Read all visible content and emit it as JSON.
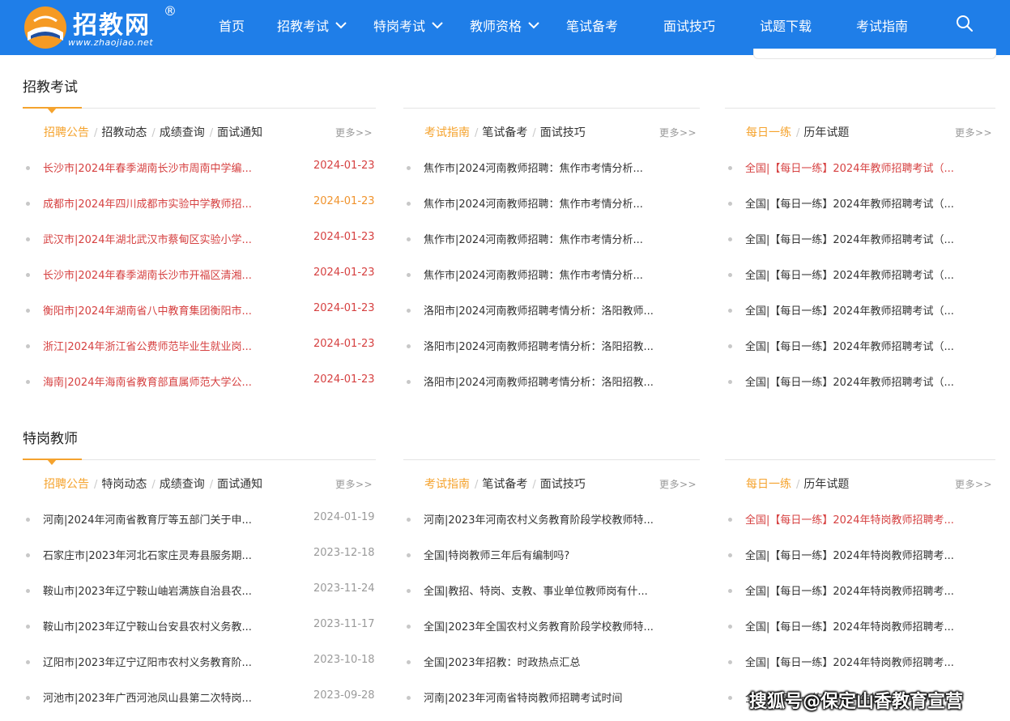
{
  "header": {
    "logo_name": "招教网",
    "logo_reg": "®",
    "logo_url": "www.zhaojiao.net",
    "nav": [
      {
        "label": "首页",
        "has_dropdown": false
      },
      {
        "label": "招教考试",
        "has_dropdown": true
      },
      {
        "label": "特岗考试",
        "has_dropdown": true
      },
      {
        "label": "教师资格",
        "has_dropdown": true
      },
      {
        "label": "笔试备考",
        "has_dropdown": false
      },
      {
        "label": "面试技巧",
        "has_dropdown": false
      },
      {
        "label": "试题下载",
        "has_dropdown": false
      },
      {
        "label": "考试指南",
        "has_dropdown": false
      }
    ],
    "search_icon": "search-icon"
  },
  "colors": {
    "header_bg": "#1f7ee8",
    "accent": "#f5a32e",
    "link_red": "#d64141",
    "date_orange": "#f0932d"
  },
  "sections": [
    {
      "title": "招教考试",
      "columns": [
        {
          "tabs": [
            "招聘公告",
            "招教动态",
            "成绩查询",
            "面试通知"
          ],
          "active_tab": 0,
          "more": "更多>>",
          "items": [
            {
              "text": "长沙市|2024年春季湖南长沙市周南中学编...",
              "date": "2024-01-23",
              "style": "red",
              "date_style": "red"
            },
            {
              "text": "成都市|2024年四川成都市实验中学教师招...",
              "date": "2024-01-23",
              "style": "red",
              "date_style": "orange"
            },
            {
              "text": "武汉市|2024年湖北武汉市蔡甸区实验小学...",
              "date": "2024-01-23",
              "style": "red",
              "date_style": "red"
            },
            {
              "text": "长沙市|2024年春季湖南长沙市开福区清湘...",
              "date": "2024-01-23",
              "style": "red",
              "date_style": "red"
            },
            {
              "text": "衡阳市|2024年湖南省八中教育集团衡阳市...",
              "date": "2024-01-23",
              "style": "red",
              "date_style": "red"
            },
            {
              "text": "浙江|2024年浙江省公费师范毕业生就业岗...",
              "date": "2024-01-23",
              "style": "red",
              "date_style": "red"
            },
            {
              "text": "海南|2024年海南省教育部直属师范大学公...",
              "date": "2024-01-23",
              "style": "red",
              "date_style": "red"
            }
          ]
        },
        {
          "tabs": [
            "考试指南",
            "笔试备考",
            "面试技巧"
          ],
          "active_tab": 0,
          "more": "更多>>",
          "items": [
            {
              "text": "焦作市|2024河南教师招聘：焦作市考情分析...",
              "style": "dark"
            },
            {
              "text": "焦作市|2024河南教师招聘：焦作市考情分析...",
              "style": "dark"
            },
            {
              "text": "焦作市|2024河南教师招聘：焦作市考情分析...",
              "style": "dark"
            },
            {
              "text": "焦作市|2024河南教师招聘：焦作市考情分析...",
              "style": "dark"
            },
            {
              "text": "洛阳市|2024河南教师招聘考情分析：洛阳教师...",
              "style": "dark"
            },
            {
              "text": "洛阳市|2024河南教师招聘考情分析：洛阳招教...",
              "style": "dark"
            },
            {
              "text": "洛阳市|2024河南教师招聘考情分析：洛阳招教...",
              "style": "dark"
            }
          ]
        },
        {
          "tabs": [
            "每日一练",
            "历年试题"
          ],
          "active_tab": 0,
          "more": "更多>>",
          "items": [
            {
              "text": "全国|【每日一练】2024年教师招聘考试（...",
              "style": "red"
            },
            {
              "text": "全国|【每日一练】2024年教师招聘考试（...",
              "style": "dark"
            },
            {
              "text": "全国|【每日一练】2024年教师招聘考试（...",
              "style": "dark"
            },
            {
              "text": "全国|【每日一练】2024年教师招聘考试（...",
              "style": "dark"
            },
            {
              "text": "全国|【每日一练】2024年教师招聘考试（...",
              "style": "dark"
            },
            {
              "text": "全国|【每日一练】2024年教师招聘考试（...",
              "style": "dark"
            },
            {
              "text": "全国|【每日一练】2024年教师招聘考试（...",
              "style": "dark"
            }
          ]
        }
      ]
    },
    {
      "title": "特岗教师",
      "columns": [
        {
          "tabs": [
            "招聘公告",
            "特岗动态",
            "成绩查询",
            "面试通知"
          ],
          "active_tab": 0,
          "more": "更多>>",
          "items": [
            {
              "text": "河南|2024年河南省教育厅等五部门关于申...",
              "date": "2024-01-19",
              "style": "dark",
              "date_style": "gray"
            },
            {
              "text": "石家庄市|2023年河北石家庄灵寿县服务期...",
              "date": "2023-12-18",
              "style": "dark",
              "date_style": "gray"
            },
            {
              "text": "鞍山市|2023年辽宁鞍山岫岩满族自治县农...",
              "date": "2023-11-24",
              "style": "dark",
              "date_style": "gray"
            },
            {
              "text": "鞍山市|2023年辽宁鞍山台安县农村义务教...",
              "date": "2023-11-17",
              "style": "dark",
              "date_style": "gray"
            },
            {
              "text": "辽阳市|2023年辽宁辽阳市农村义务教育阶...",
              "date": "2023-10-18",
              "style": "dark",
              "date_style": "gray"
            },
            {
              "text": "河池市|2023年广西河池凤山县第二次特岗...",
              "date": "2023-09-28",
              "style": "dark",
              "date_style": "gray"
            }
          ]
        },
        {
          "tabs": [
            "考试指南",
            "笔试备考",
            "面试技巧"
          ],
          "active_tab": 0,
          "more": "更多>>",
          "items": [
            {
              "text": "河南|2023年河南农村义务教育阶段学校教师特...",
              "style": "dark"
            },
            {
              "text": "全国|特岗教师三年后有编制吗?",
              "style": "dark"
            },
            {
              "text": "全国|教招、特岗、支教、事业单位教师岗有什...",
              "style": "dark"
            },
            {
              "text": "全国|2023年全国农村义务教育阶段学校教师特...",
              "style": "dark"
            },
            {
              "text": "全国|2023年招教：时政热点汇总",
              "style": "dark"
            },
            {
              "text": "河南|2023年河南省特岗教师招聘考试时间",
              "style": "dark"
            }
          ]
        },
        {
          "tabs": [
            "每日一练",
            "历年试题"
          ],
          "active_tab": 0,
          "more": "更多>>",
          "items": [
            {
              "text": "全国|【每日一练】2024年特岗教师招聘考...",
              "style": "red"
            },
            {
              "text": "全国|【每日一练】2024年特岗教师招聘考...",
              "style": "dark"
            },
            {
              "text": "全国|【每日一练】2024年特岗教师招聘考...",
              "style": "dark"
            },
            {
              "text": "全国|【每日一练】2024年特岗教师招聘考...",
              "style": "dark"
            },
            {
              "text": "全国|【每日一练】2024年特岗教师招聘考...",
              "style": "dark"
            },
            {
              "text": "全国|【每日一练】2024年特岗教师招聘考...",
              "style": "dark"
            }
          ]
        }
      ]
    }
  ],
  "watermark": "搜狐号@保定山香教育宣营"
}
